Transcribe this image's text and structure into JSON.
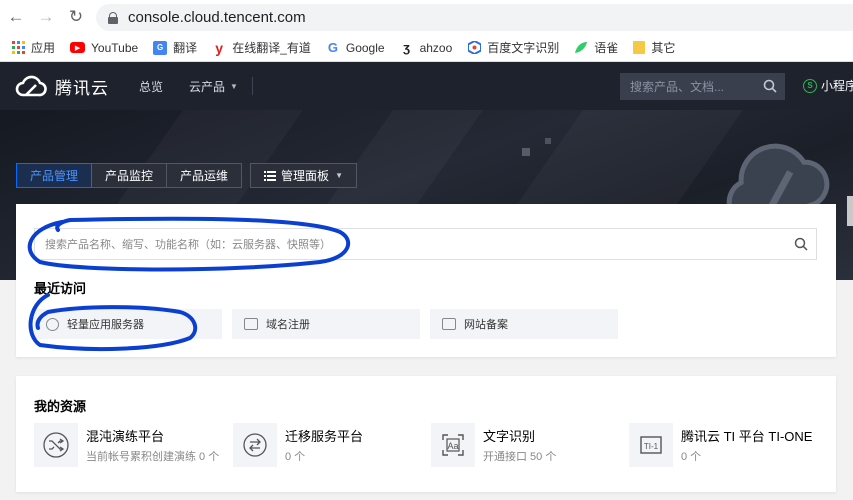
{
  "browser": {
    "url": "console.cloud.tencent.com",
    "bookmarks": [
      {
        "label": "应用",
        "icon": "apps-grid-icon"
      },
      {
        "label": "YouTube",
        "icon": "youtube-icon"
      },
      {
        "label": "翻译",
        "icon": "translate-icon"
      },
      {
        "label": "在线翻译_有道",
        "icon": "youdao-icon"
      },
      {
        "label": "Google",
        "icon": "google-icon"
      },
      {
        "label": "ahzoo",
        "icon": "ahzoo-icon"
      },
      {
        "label": "百度文字识别",
        "icon": "baidu-ocr-icon"
      },
      {
        "label": "语雀",
        "icon": "yuque-icon"
      },
      {
        "label": "其它",
        "icon": "folder-icon"
      }
    ]
  },
  "header": {
    "brand": "腾讯云",
    "nav": [
      {
        "label": "总览"
      },
      {
        "label": "云产品"
      }
    ],
    "search_placeholder": "搜索产品、文档...",
    "mini_program": "小程序"
  },
  "tabs": [
    {
      "label": "产品管理",
      "active": true
    },
    {
      "label": "产品监控",
      "active": false
    },
    {
      "label": "产品运维",
      "active": false
    }
  ],
  "panel_tab": "管理面板",
  "search": {
    "placeholder": "搜索产品名称、缩写、功能名称（如：云服务器、快照等）"
  },
  "recent": {
    "title": "最近访问",
    "items": [
      {
        "label": "轻量应用服务器",
        "icon": "lighthouse-icon"
      },
      {
        "label": "域名注册",
        "icon": "domain-icon"
      },
      {
        "label": "网站备案",
        "icon": "record-icon"
      }
    ]
  },
  "resources": {
    "title": "我的资源",
    "items": [
      {
        "name": "混沌演练平台",
        "sub": "当前帐号累积创建演练 0 个",
        "icon": "shuffle-icon"
      },
      {
        "name": "迁移服务平台",
        "sub": "0 个",
        "icon": "migrate-icon"
      },
      {
        "name": "文字识别",
        "sub": "开通接口 50 个",
        "icon": "ocr-icon"
      },
      {
        "name": "腾讯云 TI 平台 TI-ONE",
        "sub": "0 个",
        "icon": "ti-one-icon"
      }
    ]
  },
  "colors": {
    "header_bg": "#1e222d",
    "accent": "#006eff",
    "annotation_pen": "#0a3fd1"
  }
}
